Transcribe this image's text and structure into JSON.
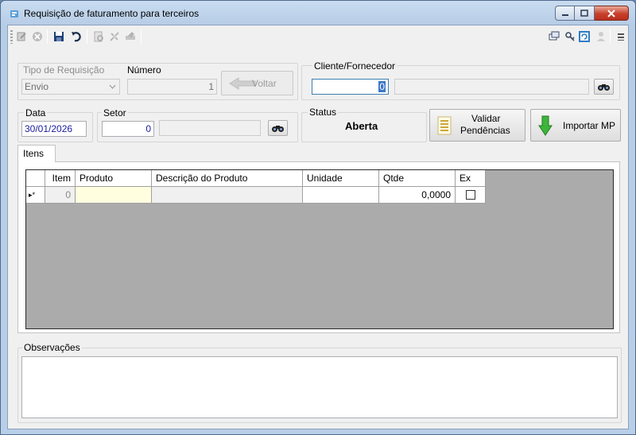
{
  "window": {
    "title": "Requisição de faturamento para terceiros"
  },
  "form": {
    "tipo_requisicao_label": "Tipo de Requisição",
    "tipo_requisicao_value": "Envio",
    "numero_label": "Número",
    "numero_value": "1",
    "voltar_label": "Voltar",
    "cliente_label": "Cliente/Fornecedor",
    "cliente_code": "0",
    "cliente_name": "",
    "data_label": "Data",
    "data_value": "30/01/2026",
    "setor_label": "Setor",
    "setor_code": "0",
    "setor_name": "",
    "status_label": "Status",
    "status_value": "Aberta",
    "validar_label_1": "Validar",
    "validar_label_2": "Pendências",
    "importar_label": "Importar MP"
  },
  "tabs": [
    {
      "label": "Itens"
    }
  ],
  "grid": {
    "columns": [
      "Item",
      "Produto",
      "Descrição do Produto",
      "Unidade",
      "Qtde",
      "Ex"
    ],
    "new_row": {
      "indicator": "▸*",
      "item": "0",
      "produto": "",
      "descricao": "",
      "unidade": "",
      "qtde": "0,0000",
      "ex": false
    }
  },
  "observacoes": {
    "label": "Observações",
    "value": ""
  }
}
